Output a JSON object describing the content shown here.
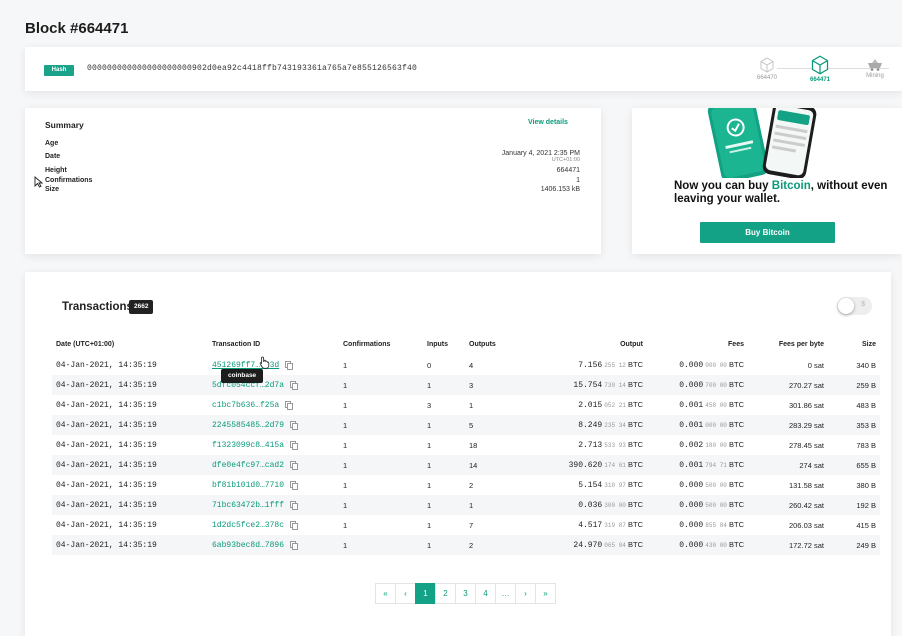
{
  "page": {
    "title": "Block #664471"
  },
  "hash": {
    "badge": "Hash",
    "value": "000000000000000000000902d0ea92c4418ffb743193361a765a7e855126563f40"
  },
  "block_nav": {
    "prev": "664470",
    "current": "664471",
    "next": "Mining"
  },
  "summary": {
    "title": "Summary",
    "view_details": "View details",
    "labels": {
      "age": "Age",
      "date": "Date",
      "height": "Height",
      "confirmations": "Confirmations",
      "size": "Size"
    },
    "values": {
      "date": "January 4, 2021 2:35 PM",
      "timezone": "UTC+01:00",
      "height": "664471",
      "confirmations": "1",
      "size": "1406.153 kB"
    }
  },
  "promo": {
    "text_before": "Now you can buy ",
    "text_highlight": "Bitcoin",
    "text_after": ", without even leaving your wallet.",
    "button": "Buy Bitcoin"
  },
  "transactions": {
    "title": "Transactions",
    "count": "2662",
    "toggle_label": "$",
    "tooltip": "coinbase",
    "columns": [
      "Date (UTC+01:00)",
      "Transaction ID",
      "Confirmations",
      "Inputs",
      "Outputs",
      "Output",
      "Fees",
      "Fees per byte",
      "Size"
    ],
    "rows": [
      {
        "date": "04-Jan-2021, 14:35:19",
        "txid": "451269ff7…843d",
        "conf": "1",
        "inputs": "0",
        "outputs": "4",
        "out_main": "7.156",
        "out_dim": "255 12",
        "fee_main": "0.000",
        "fee_dim": "000 00",
        "unit": "BTC",
        "fpb": "0 sat",
        "size": "340 B"
      },
      {
        "date": "04-Jan-2021, 14:35:19",
        "txid": "5dfc054ccf…2d7a",
        "conf": "1",
        "inputs": "1",
        "outputs": "3",
        "out_main": "15.754",
        "out_dim": "730 14",
        "fee_main": "0.000",
        "fee_dim": "700 00",
        "unit": "BTC",
        "fpb": "270.27 sat",
        "size": "259 B"
      },
      {
        "date": "04-Jan-2021, 14:35:19",
        "txid": "c1bc7b636…f25a",
        "conf": "1",
        "inputs": "3",
        "outputs": "1",
        "out_main": "2.015",
        "out_dim": "052 21",
        "fee_main": "0.001",
        "fee_dim": "458 00",
        "unit": "BTC",
        "fpb": "301.86 sat",
        "size": "483 B"
      },
      {
        "date": "04-Jan-2021, 14:35:19",
        "txid": "2245585485…2d79",
        "conf": "1",
        "inputs": "1",
        "outputs": "5",
        "out_main": "8.249",
        "out_dim": "235 34",
        "fee_main": "0.001",
        "fee_dim": "000 00",
        "unit": "BTC",
        "fpb": "283.29 sat",
        "size": "353 B"
      },
      {
        "date": "04-Jan-2021, 14:35:19",
        "txid": "f1323099c8…415a",
        "conf": "1",
        "inputs": "1",
        "outputs": "18",
        "out_main": "2.713",
        "out_dim": "533 93",
        "fee_main": "0.002",
        "fee_dim": "180 00",
        "unit": "BTC",
        "fpb": "278.45 sat",
        "size": "783 B"
      },
      {
        "date": "04-Jan-2021, 14:35:19",
        "txid": "dfe0e4fc97…cad2",
        "conf": "1",
        "inputs": "1",
        "outputs": "14",
        "out_main": "390.620",
        "out_dim": "174 61",
        "fee_main": "0.001",
        "fee_dim": "794 71",
        "unit": "BTC",
        "fpb": "274 sat",
        "size": "655 B"
      },
      {
        "date": "04-Jan-2021, 14:35:19",
        "txid": "bf81b101d0…7710",
        "conf": "1",
        "inputs": "1",
        "outputs": "2",
        "out_main": "5.154",
        "out_dim": "310 97",
        "fee_main": "0.000",
        "fee_dim": "500 00",
        "unit": "BTC",
        "fpb": "131.58 sat",
        "size": "380 B"
      },
      {
        "date": "04-Jan-2021, 14:35:19",
        "txid": "71bc63472b…1fff",
        "conf": "1",
        "inputs": "1",
        "outputs": "1",
        "out_main": "0.036",
        "out_dim": "300 00",
        "fee_main": "0.000",
        "fee_dim": "500 00",
        "unit": "BTC",
        "fpb": "260.42 sat",
        "size": "192 B"
      },
      {
        "date": "04-Jan-2021, 14:35:19",
        "txid": "1d2dc5fce2…378c",
        "conf": "1",
        "inputs": "1",
        "outputs": "7",
        "out_main": "4.517",
        "out_dim": "319 87",
        "fee_main": "0.000",
        "fee_dim": "855 84",
        "unit": "BTC",
        "fpb": "206.03 sat",
        "size": "415 B"
      },
      {
        "date": "04-Jan-2021, 14:35:19",
        "txid": "6ab93bec8d…7896",
        "conf": "1",
        "inputs": "1",
        "outputs": "2",
        "out_main": "24.970",
        "out_dim": "065 04",
        "fee_main": "0.000",
        "fee_dim": "430 00",
        "unit": "BTC",
        "fpb": "172.72 sat",
        "size": "249 B"
      }
    ]
  },
  "pagination": {
    "first": "«",
    "prev": "‹",
    "pages": [
      "1",
      "2",
      "3",
      "4",
      "…"
    ],
    "next": "›",
    "last": "»",
    "current": "1"
  },
  "colors": {
    "accent": "#14a286",
    "text": "#222222",
    "badge_dark": "#222222"
  },
  "icons": {
    "copy": "copy-icon",
    "cube": "cube-icon",
    "mining": "mining-cart-icon",
    "cursor": "cursor-arrow-icon",
    "hand": "hand-pointer-icon"
  }
}
